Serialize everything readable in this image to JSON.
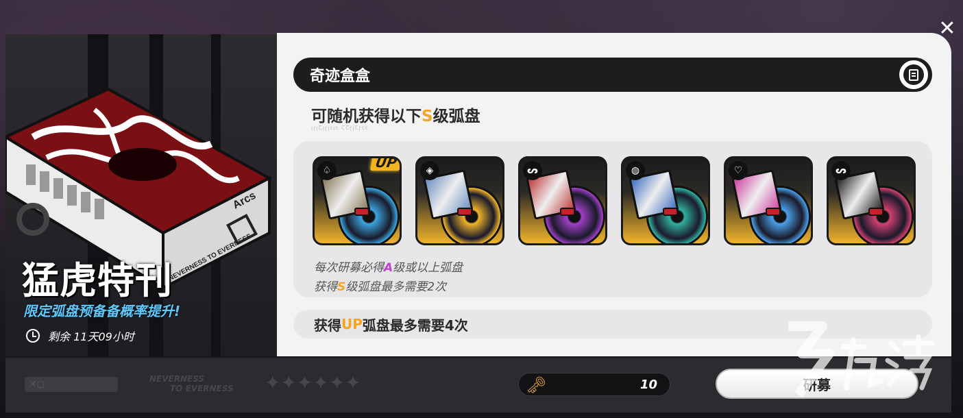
{
  "banner": {
    "title": "猛虎特刊",
    "subtitle": "限定弧盘预备备概率提升!",
    "timer": "剩余 11天09小时",
    "box_label": "Arcs",
    "box_slogan": "NEVERNESS TO EVERNESS"
  },
  "header": {
    "title": "奇迹盒盒"
  },
  "pool": {
    "subtitle_prefix": "可随机获得以下",
    "subtitle_accent": "S",
    "subtitle_suffix": "级弧盘",
    "subtitle_deco": "ꞁꞅꞁꞆꞁꞅꞁꞇꞁꞇ ꞆꞆꞅꞁꞆꞅꞇꞇ",
    "discs": [
      {
        "badge": "♤",
        "up": true,
        "disc_color": "#3aa6e0",
        "art_color": "#8a7a5a"
      },
      {
        "badge": "◈",
        "up": false,
        "disc_color": "#f0b42a",
        "art_color": "#6a8ec0"
      },
      {
        "badge": "ᔕ",
        "up": false,
        "disc_color": "#a040c8",
        "art_color": "#c03a3a"
      },
      {
        "badge": "◍",
        "up": false,
        "disc_color": "#30b0a0",
        "art_color": "#3a6ec0"
      },
      {
        "badge": "♡",
        "up": false,
        "disc_color": "#4aa0e8",
        "art_color": "#d040a0"
      },
      {
        "badge": "ᔕ",
        "up": false,
        "disc_color": "#d04070",
        "art_color": "#202020"
      }
    ],
    "up_label": "UP",
    "rule1_prefix": "每次研募必得",
    "rule1_accent": "A",
    "rule1_suffix": "级或以上弧盘",
    "rule2_prefix": "获得",
    "rule2_accent": "S",
    "rule2_suffix": "级弧盘最多需要2次"
  },
  "up_rule": {
    "prefix": "获得",
    "accent": "UP",
    "suffix": "弧盘最多需要4次"
  },
  "bottom": {
    "logo_text": "✕◻",
    "never_line1": "NEVERNESS",
    "never_line2": "TO EVERNESS",
    "stars": "✦✦✦✦✦✦",
    "key_icon": "🗝",
    "key_count": "10",
    "recruit_label": "研募"
  },
  "close_icon": "✕",
  "colors": {
    "accent_gold": "#f2a623",
    "accent_purple": "#c23fd4",
    "accent_blue": "#5ec8ff"
  }
}
